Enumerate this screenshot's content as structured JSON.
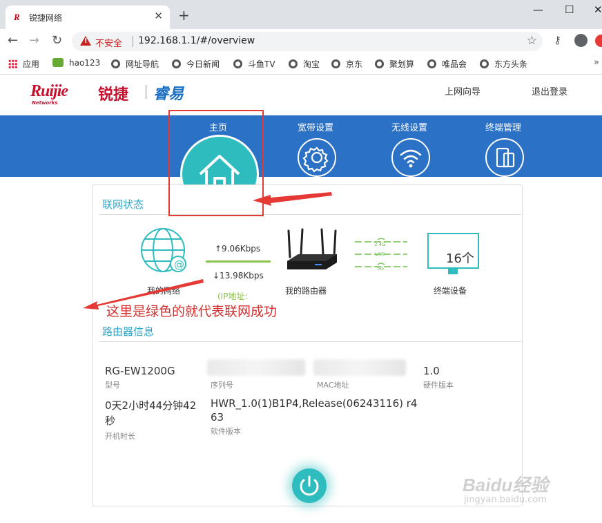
{
  "browser": {
    "tab_title": "锐捷网络",
    "tab_favicon": "R",
    "close_glyph": "✕",
    "new_tab_glyph": "+",
    "window_controls": [
      "—",
      "☐",
      "✕"
    ],
    "nav_glyphs": {
      "back": "←",
      "forward": "→",
      "reload": "↻"
    },
    "security_label": "不安全",
    "url": "192.168.1.1/#/overview",
    "star_glyph": "☆",
    "key_glyph": "⚷",
    "bookmarks": [
      {
        "label": "应用",
        "icon": "apps-icon"
      },
      {
        "label": "hao123",
        "icon": "hao123-icon"
      },
      {
        "label": "网址导航",
        "icon": "globe-icon"
      },
      {
        "label": "今日新闻",
        "icon": "globe-icon"
      },
      {
        "label": "斗鱼TV",
        "icon": "globe-icon"
      },
      {
        "label": "淘宝",
        "icon": "globe-icon"
      },
      {
        "label": "京东",
        "icon": "globe-icon"
      },
      {
        "label": "聚划算",
        "icon": "globe-icon"
      },
      {
        "label": "唯品会",
        "icon": "globe-icon"
      },
      {
        "label": "东方头条",
        "icon": "globe-icon"
      }
    ],
    "bookmarks_more": "»"
  },
  "header": {
    "logo_text": "Ruijie",
    "logo_sub": "Networks",
    "logo_cn": "锐捷",
    "brand": "睿易",
    "wizard_label": "上网向导",
    "logout_label": "退出登录"
  },
  "nav": {
    "items": [
      {
        "label": "主页",
        "icon": "home-icon",
        "active": true
      },
      {
        "label": "宽带设置",
        "icon": "gear-icon"
      },
      {
        "label": "无线设置",
        "icon": "wifi-icon"
      },
      {
        "label": "终端管理",
        "icon": "devices-icon"
      }
    ]
  },
  "status": {
    "title": "联网状态",
    "my_network_label": "我的网络",
    "upload_speed": "↑9.06Kbps",
    "download_speed": "↓13.98Kbps",
    "ip_label": "(IP地址:",
    "my_router_label": "我的路由器",
    "band_labels": [
      "2.4G",
      "LAN",
      "5G"
    ],
    "device_count": "16个",
    "devices_label": "终端设备",
    "link_color": "#8bc34a"
  },
  "router_info": {
    "title": "路由器信息",
    "fields": [
      {
        "value": "RG-EW1200G",
        "label": "型号"
      },
      {
        "value": "",
        "label": "序列号"
      },
      {
        "value": "",
        "label": "MAC地址"
      },
      {
        "value": "1.0",
        "label": "硬件版本"
      },
      {
        "value": "0天2小时44分钟42秒",
        "label": "开机时长"
      },
      {
        "value": "HWR_1.0(1)B1P4,Release(06243116) r463",
        "label": "软件版本"
      }
    ]
  },
  "annotation": {
    "text": "这里是绿色的就代表联网成功",
    "color": "#d32f2f"
  },
  "watermark": {
    "text": "Baidu经验",
    "url": "jingyan.baidu.com"
  },
  "colors": {
    "nav_blue": "#2b71c6",
    "teal": "#2fbcbf",
    "section_title": "#2fa6c9",
    "brand_red": "#c8102e"
  }
}
